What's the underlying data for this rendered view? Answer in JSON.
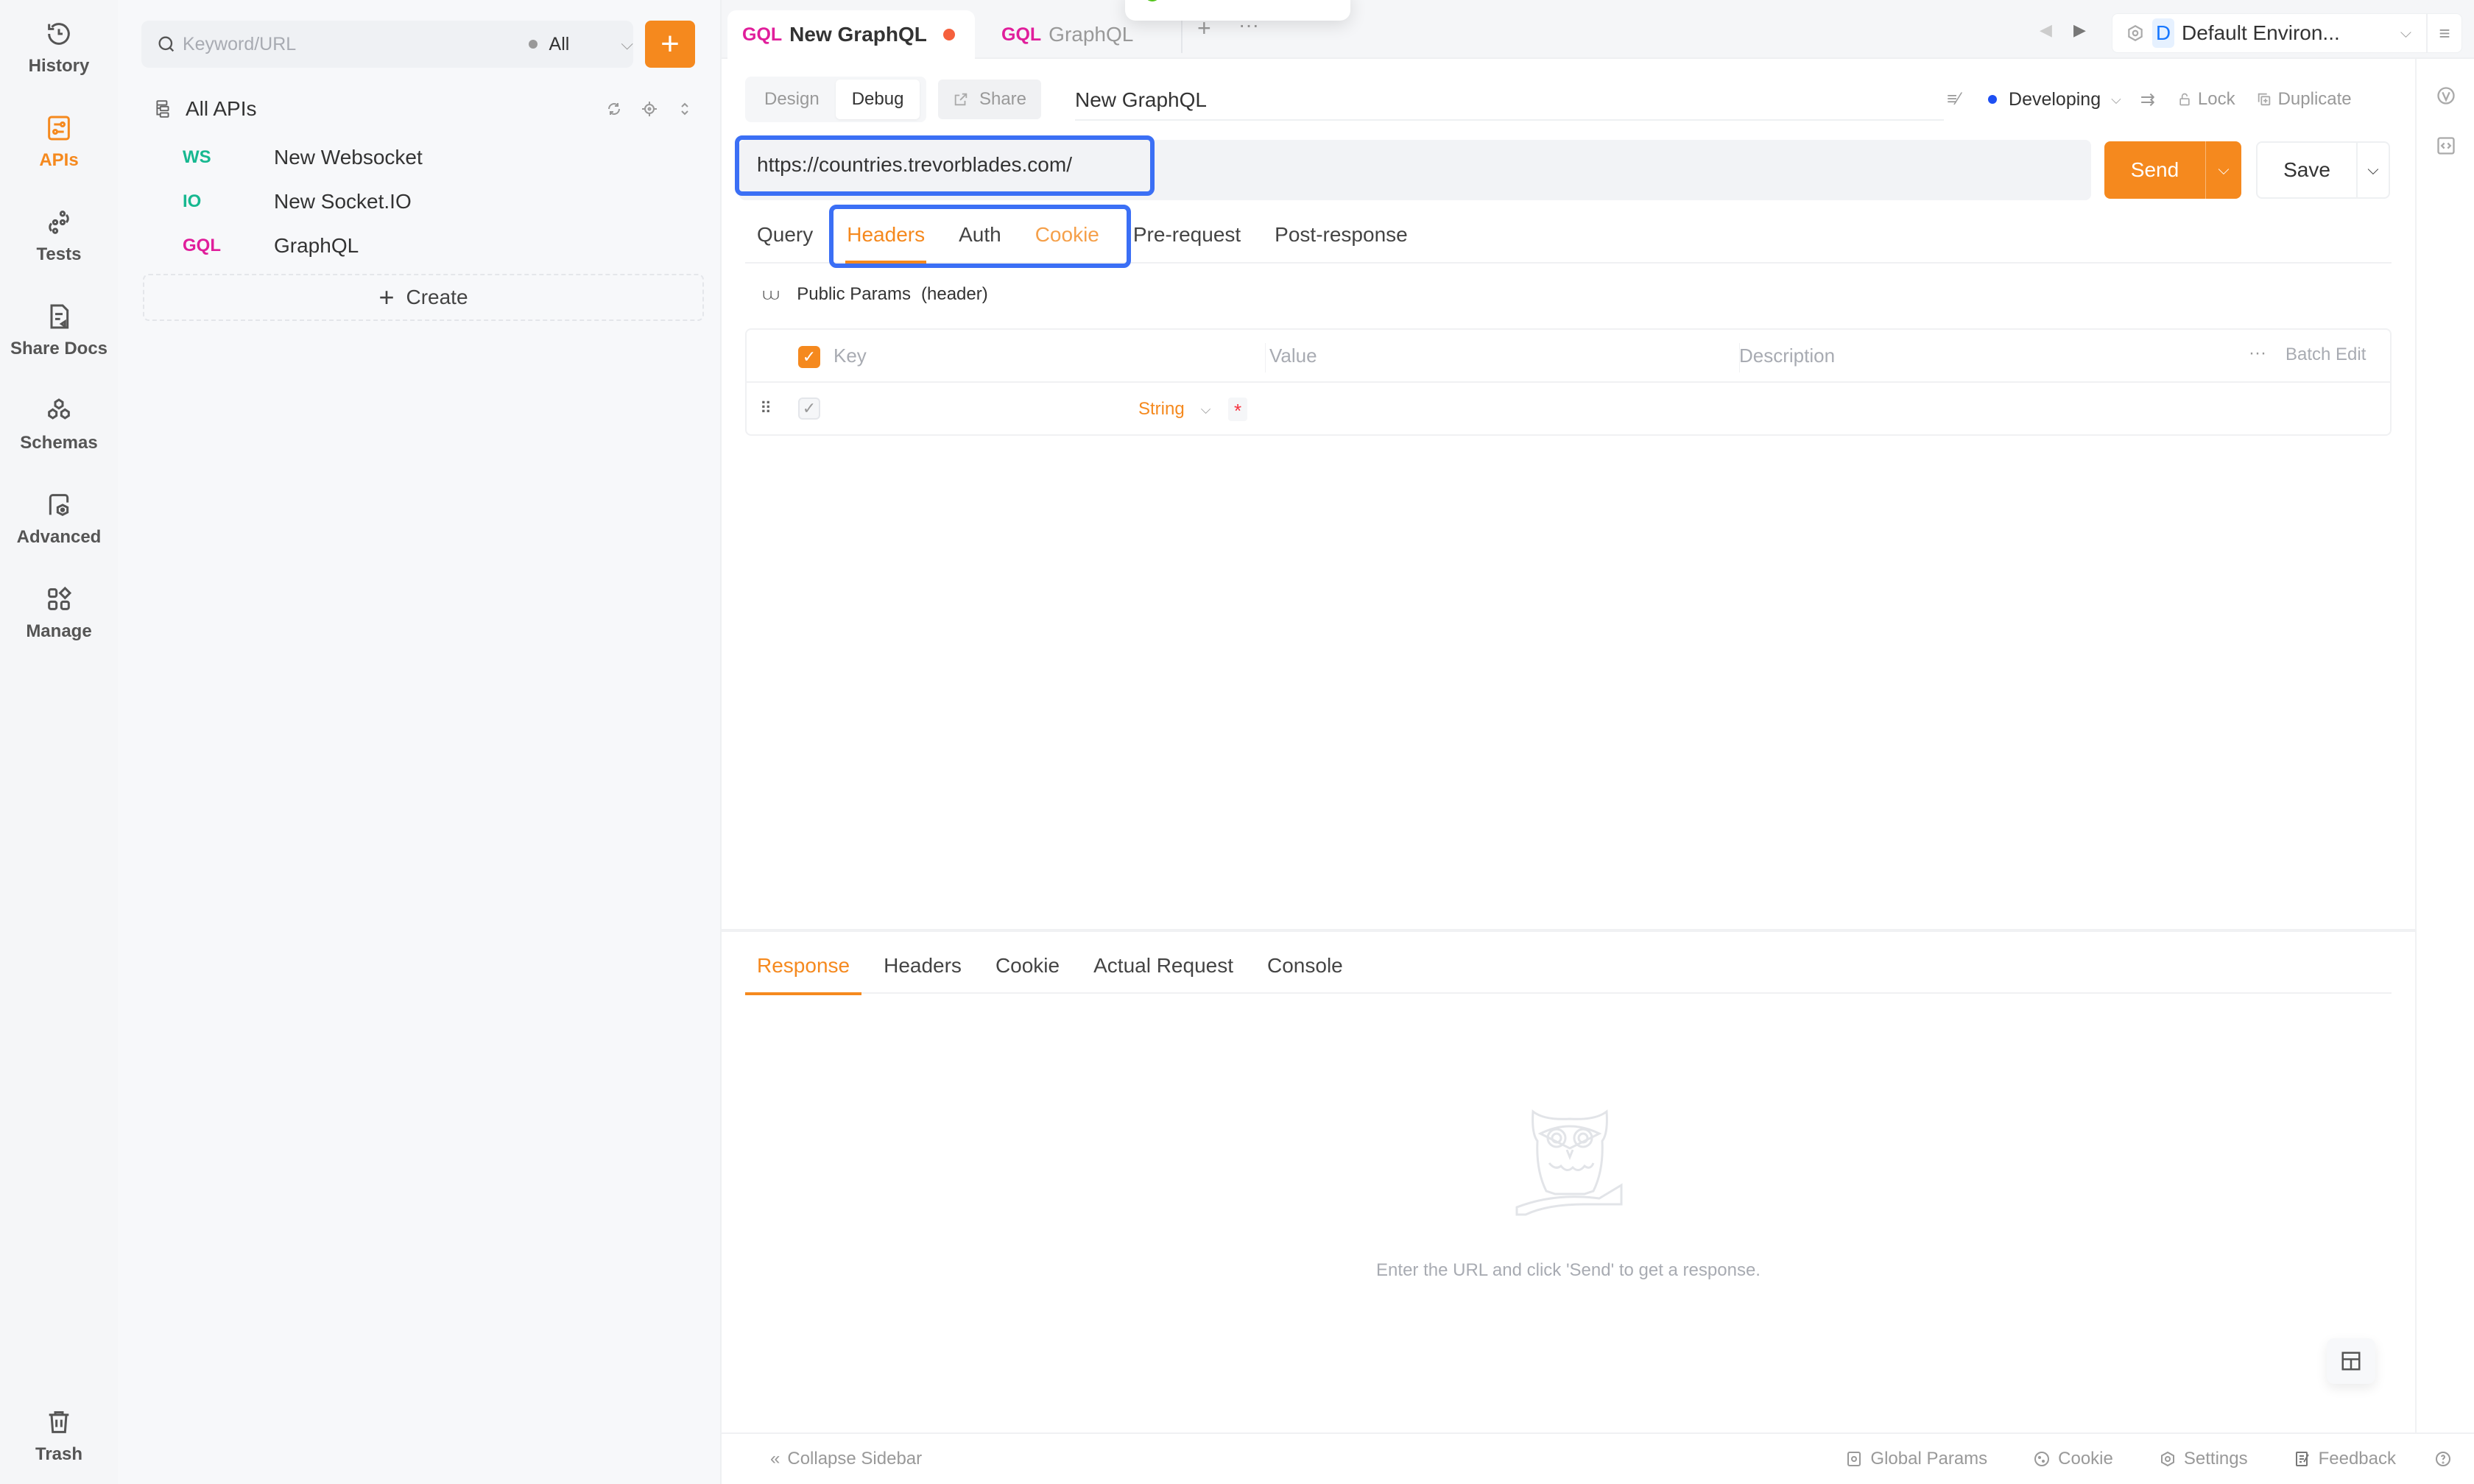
{
  "rail": {
    "items": [
      {
        "label": "History",
        "icon": "history-icon"
      },
      {
        "label": "APIs",
        "icon": "apis-icon",
        "active": true
      },
      {
        "label": "Tests",
        "icon": "tests-icon"
      },
      {
        "label": "Share Docs",
        "icon": "share-docs-icon"
      },
      {
        "label": "Schemas",
        "icon": "schemas-icon"
      },
      {
        "label": "Advanced",
        "icon": "advanced-icon"
      },
      {
        "label": "Manage",
        "icon": "manage-icon"
      }
    ],
    "trash_label": "Trash"
  },
  "sidebar": {
    "search_placeholder": "Keyword/URL",
    "filter_value": "All",
    "add_label": "+",
    "tree_root": "All APIs",
    "apis": [
      {
        "method": "WS",
        "name": "New Websocket",
        "color": "#17b890"
      },
      {
        "method": "IO",
        "name": "New Socket.IO",
        "color": "#17b890"
      },
      {
        "method": "GQL",
        "name": "GraphQL",
        "color": "#e01e9b"
      }
    ],
    "create_label": "Create"
  },
  "tabs": [
    {
      "method": "GQL",
      "name": "New GraphQL",
      "active": true,
      "unsaved": true
    },
    {
      "method": "GQL",
      "name": "GraphQL",
      "active": false
    }
  ],
  "environment": {
    "badge": "D",
    "name": "Default Environ..."
  },
  "toolbar": {
    "modes": [
      "Design",
      "Debug"
    ],
    "active_mode": "Debug",
    "share_label": "Share",
    "api_name": "New GraphQL",
    "status": "Developing",
    "lock_label": "Lock",
    "duplicate_label": "Duplicate"
  },
  "request": {
    "url": "https://countries.trevorblades.com/",
    "send_label": "Send",
    "save_label": "Save",
    "tabs": [
      "Query",
      "Headers",
      "Auth",
      "Cookie",
      "Pre-request",
      "Post-response"
    ],
    "active_tab": "Headers",
    "public_params_label": "Public Params",
    "public_params_scope": "(header)"
  },
  "params_table": {
    "columns": {
      "key": "Key",
      "value": "Value",
      "description": "Description"
    },
    "batch_edit_label": "Batch Edit",
    "rows": [
      {
        "key": "",
        "type": "String",
        "value": "",
        "description": "",
        "required": true
      }
    ]
  },
  "response": {
    "tabs": [
      "Response",
      "Headers",
      "Cookie",
      "Actual Request",
      "Console"
    ],
    "active_tab": "Response",
    "empty_message": "Enter the URL and click 'Send' to get a response."
  },
  "statusbar": {
    "collapse_label": "Collapse Sidebar",
    "global_params_label": "Global Params",
    "cookie_label": "Cookie",
    "settings_label": "Settings",
    "feedback_label": "Feedback"
  },
  "colors": {
    "accent": "#f5891e",
    "gql": "#e01e9b",
    "ws": "#17b890",
    "highlight": "#3b6ff5",
    "status_dot": "#1d4ff3"
  }
}
